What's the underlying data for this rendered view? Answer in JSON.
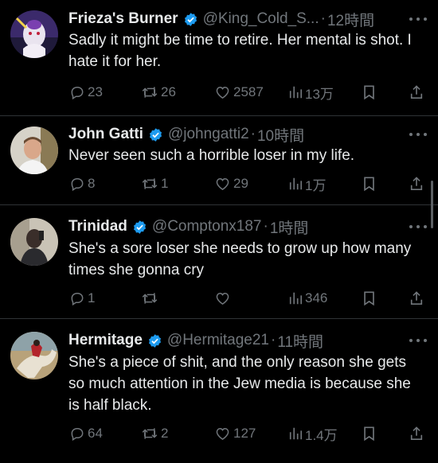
{
  "colors": {
    "background": "#000000",
    "text": "#e7e9ea",
    "muted": "#71767b",
    "verified": "#1d9bf0",
    "divider": "#2f3336"
  },
  "tweets": [
    {
      "name": "Frieza's Burner",
      "handle": "@King_Cold_S...",
      "time": "12時間",
      "text": "Sadly it might be time to retire. Her mental is shot. I hate it for her.",
      "replies": "23",
      "retweets": "26",
      "likes": "2587",
      "views": "13万",
      "avatar_icon": "anime-character-avatar"
    },
    {
      "name": "John Gatti",
      "handle": "@johngatti2",
      "time": "10時間",
      "text": "Never seen such a horrible loser in my life.",
      "replies": "8",
      "retweets": "1",
      "likes": "29",
      "views": "1万",
      "avatar_icon": "person-photo-avatar"
    },
    {
      "name": "Trinidad",
      "handle": "@Comptonx187",
      "time": "1時間",
      "text": "She's a sore loser she needs to grow up how many times she gonna cry",
      "replies": "1",
      "retweets": "",
      "likes": "",
      "views": "346",
      "avatar_icon": "person-selfie-avatar"
    },
    {
      "name": "Hermitage",
      "handle": "@Hermitage21",
      "time": "11時間",
      "text": "She's a piece of shit, and the only reason she gets so much attention in the Jew media is because she is half black.",
      "replies": "64",
      "retweets": "2",
      "likes": "127",
      "views": "1.4万",
      "avatar_icon": "painting-rider-avatar"
    }
  ]
}
